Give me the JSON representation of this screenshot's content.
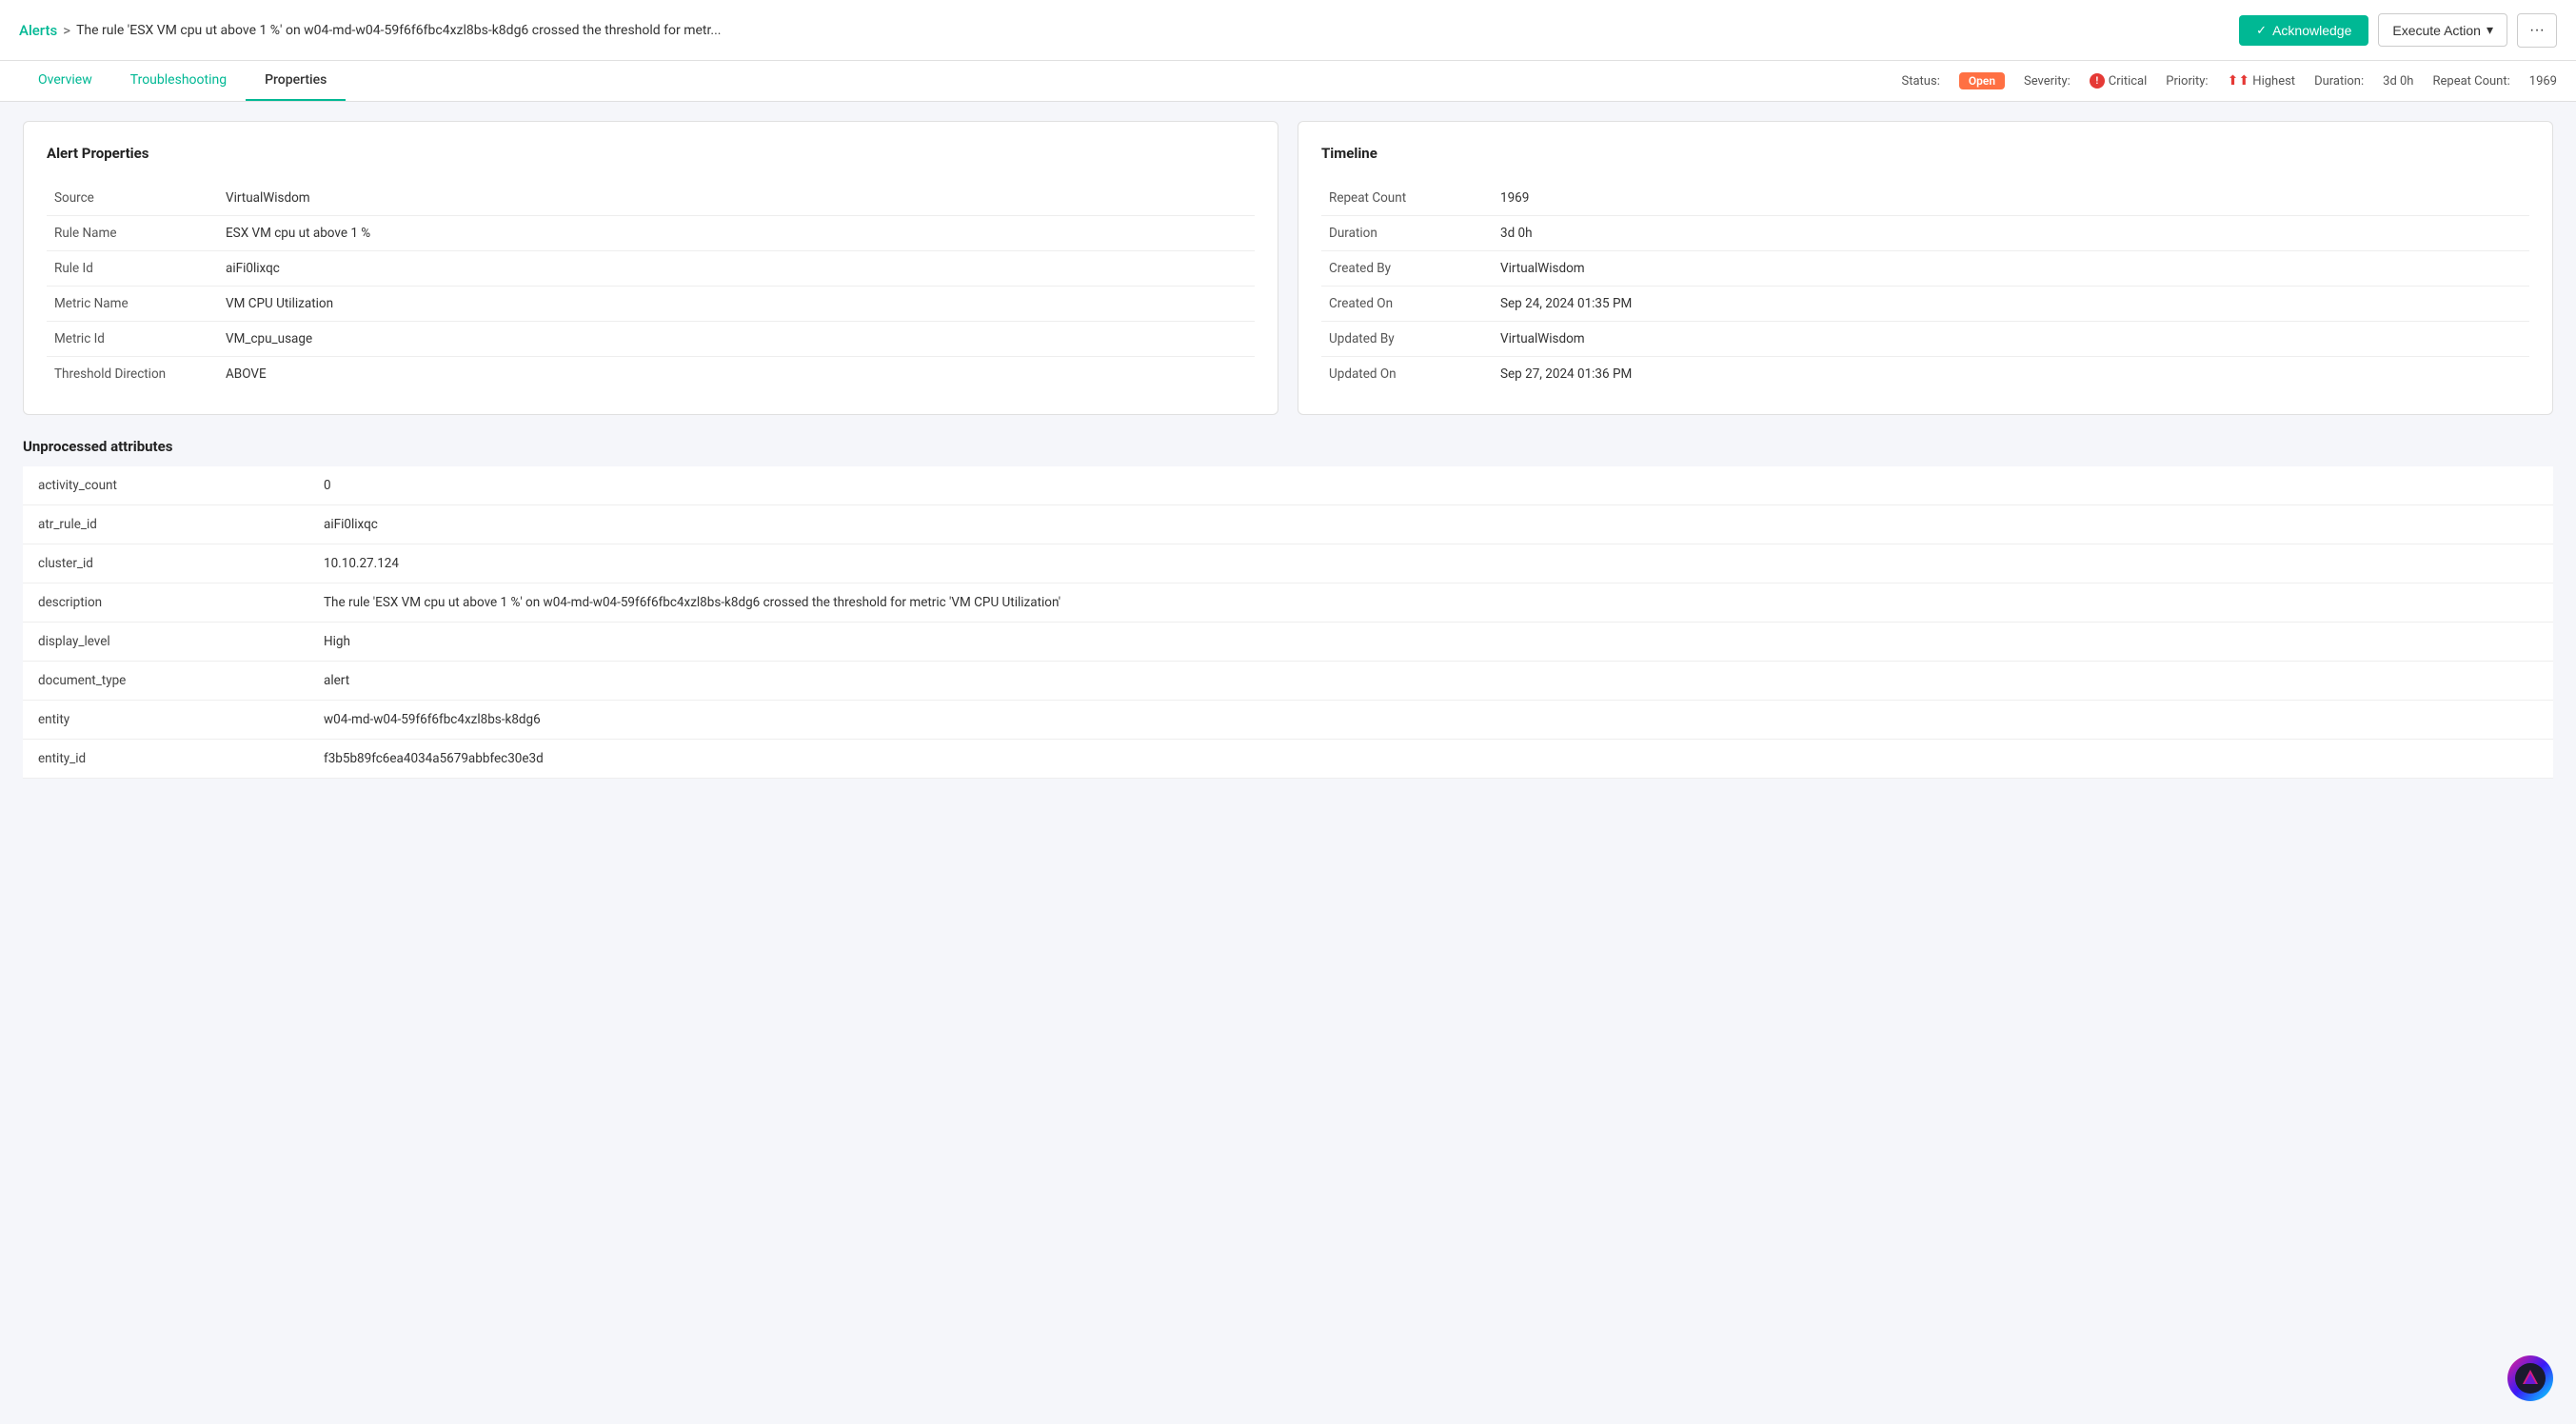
{
  "header": {
    "breadcrumb_alerts": "Alerts",
    "breadcrumb_sep": ">",
    "breadcrumb_title": "The rule 'ESX VM cpu ut above 1 %' on w04-md-w04-59f6f6fbc4xzl8bs-k8dg6 crossed the threshold for metr...",
    "acknowledge_label": "Acknowledge",
    "execute_action_label": "Execute Action",
    "more_icon": "···"
  },
  "tabs": {
    "overview_label": "Overview",
    "troubleshooting_label": "Troubleshooting",
    "properties_label": "Properties",
    "active": "Properties"
  },
  "status_bar": {
    "status_label": "Status:",
    "status_value": "Open",
    "severity_label": "Severity:",
    "severity_value": "Critical",
    "priority_label": "Priority:",
    "priority_value": "Highest",
    "duration_label": "Duration:",
    "duration_value": "3d 0h",
    "repeat_count_label": "Repeat Count:",
    "repeat_count_value": "1969"
  },
  "alert_properties": {
    "title": "Alert Properties",
    "rows": [
      {
        "label": "Source",
        "value": "VirtualWisdom"
      },
      {
        "label": "Rule Name",
        "value": "ESX VM cpu ut above 1 %"
      },
      {
        "label": "Rule Id",
        "value": "aiFi0lixqc"
      },
      {
        "label": "Metric Name",
        "value": "VM CPU Utilization"
      },
      {
        "label": "Metric Id",
        "value": "VM_cpu_usage"
      },
      {
        "label": "Threshold Direction",
        "value": "ABOVE"
      }
    ]
  },
  "timeline": {
    "title": "Timeline",
    "rows": [
      {
        "label": "Repeat Count",
        "value": "1969"
      },
      {
        "label": "Duration",
        "value": "3d 0h"
      },
      {
        "label": "Created By",
        "value": "VirtualWisdom"
      },
      {
        "label": "Created On",
        "value": "Sep 24, 2024 01:35 PM"
      },
      {
        "label": "Updated By",
        "value": "VirtualWisdom"
      },
      {
        "label": "Updated On",
        "value": "Sep 27, 2024 01:36 PM"
      }
    ]
  },
  "unprocessed_attributes": {
    "title": "Unprocessed attributes",
    "rows": [
      {
        "key": "activity_count",
        "value": "0"
      },
      {
        "key": "atr_rule_id",
        "value": "aiFi0lixqc"
      },
      {
        "key": "cluster_id",
        "value": "10.10.27.124"
      },
      {
        "key": "description",
        "value": "The rule 'ESX VM cpu ut above 1 %' on w04-md-w04-59f6f6fbc4xzl8bs-k8dg6 crossed the threshold for metric 'VM CPU Utilization'"
      },
      {
        "key": "display_level",
        "value": "High"
      },
      {
        "key": "document_type",
        "value": "alert"
      },
      {
        "key": "entity",
        "value": "w04-md-w04-59f6f6fbc4xzl8bs-k8dg6"
      },
      {
        "key": "entity_id",
        "value": "f3b5b89fc6ea4034a5679abbfec30e3d"
      }
    ]
  }
}
